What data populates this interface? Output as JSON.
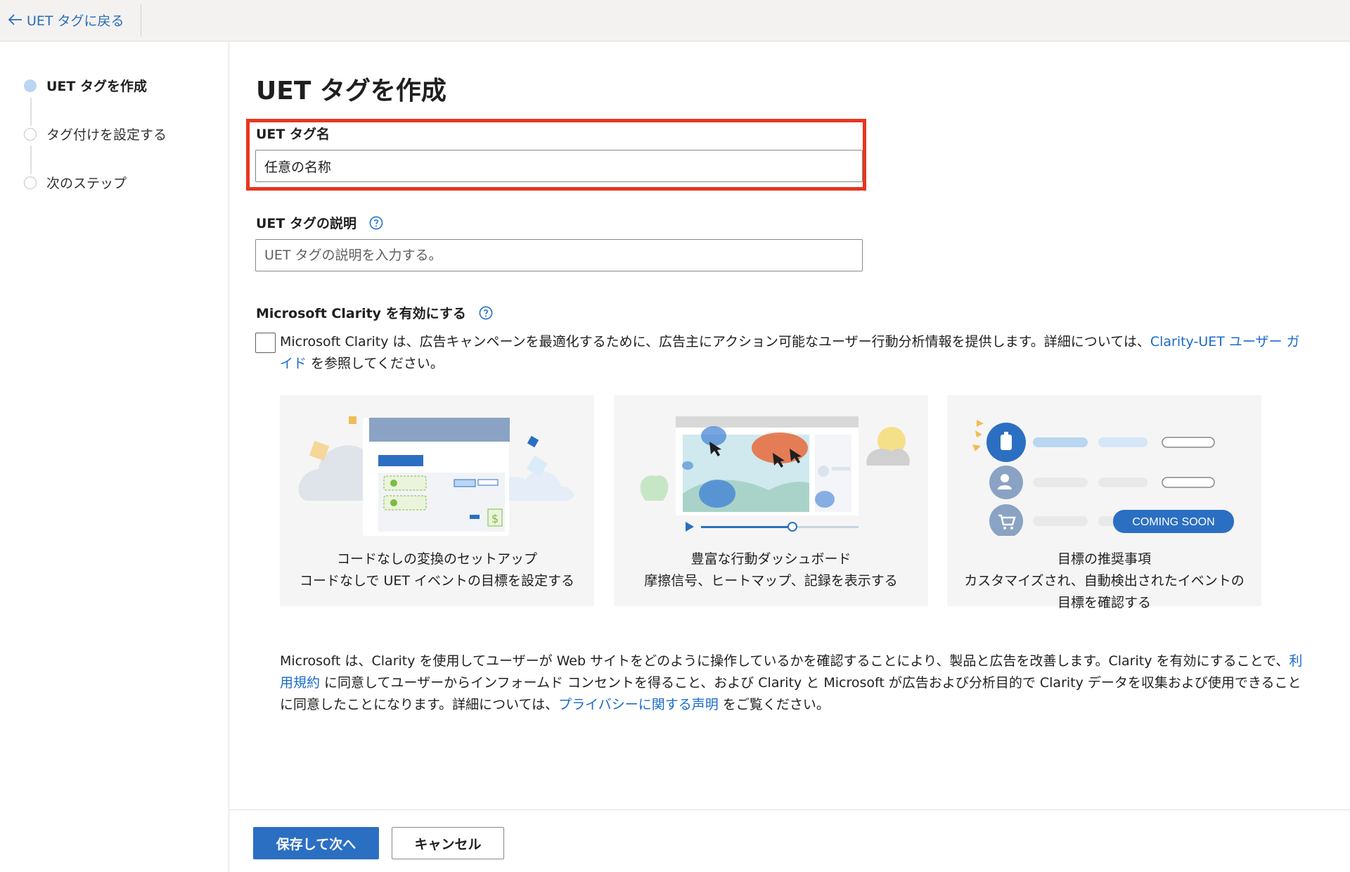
{
  "topbar": {
    "back_label": "UET タグに戻る"
  },
  "sidebar": {
    "steps": [
      {
        "label": "UET タグを作成",
        "active": true
      },
      {
        "label": "タグ付けを設定する",
        "active": false
      },
      {
        "label": "次のステップ",
        "active": false
      }
    ]
  },
  "main": {
    "title": "UET タグを作成",
    "name_field": {
      "label": "UET タグ名",
      "value": "任意の名称"
    },
    "description_field": {
      "label": "UET タグの説明",
      "placeholder": "UET タグの説明を入力する。"
    },
    "clarity": {
      "label": "Microsoft Clarity を有効にする",
      "checked": false,
      "desc_before": "Microsoft Clarity は、広告キャンペーンを最適化するために、広告主にアクション可能なユーザー行動分析情報を提供します。詳細については、",
      "desc_link": "Clarity-UET ユーザー ガイド",
      "desc_after": " を参照してください。"
    },
    "cards": [
      {
        "lines": [
          "コードなしの変換のセットアップ",
          "コードなしで UET イベントの目標を設定する"
        ]
      },
      {
        "lines": [
          "豊富な行動ダッシュボード",
          "摩擦信号、ヒートマップ、記録を表示する"
        ]
      },
      {
        "lines": [
          "目標の推奨事項",
          "カスタマイズされ、自動検出されたイベントの",
          "目標を確認する"
        ],
        "badge": "COMING SOON"
      }
    ],
    "disclaimer": {
      "part1": "Microsoft は、Clarity を使用してユーザーが Web サイトをどのように操作しているかを確認することにより、製品と広告を改善します。Clarity を有効にすることで、",
      "link1": "利用規約",
      "part2": " に同意してユーザーからインフォームド コンセントを得ること、および Clarity と Microsoft が広告および分析目的で Clarity データを収集および使用できることに同意したことになります。詳細については、",
      "link2": "プライバシーに関する声明",
      "part3": " をご覧ください。"
    }
  },
  "footer": {
    "save_label": "保存して次へ",
    "cancel_label": "キャンセル"
  },
  "colors": {
    "accent": "#2b6fc2",
    "link": "#1a6bc8",
    "highlight": "#e8361e"
  }
}
